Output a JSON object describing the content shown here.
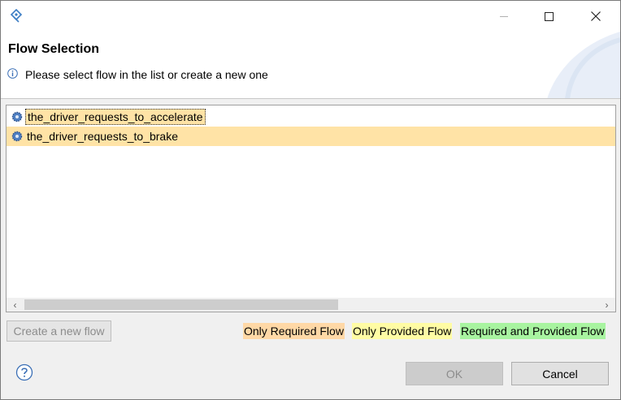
{
  "window": {
    "app_icon": "capella-app-icon",
    "controls": {
      "minimize": "minimize-icon",
      "maximize": "maximize-icon",
      "close": "close-icon"
    }
  },
  "header": {
    "title": "Flow Selection",
    "message": "Please select flow in the list or create a new one",
    "message_icon": "info-icon"
  },
  "flow_list": {
    "items": [
      {
        "label": "the_driver_requests_to_accelerate",
        "icon": "gear-flow-icon",
        "focused": true
      },
      {
        "label": "the_driver_requests_to_brake",
        "icon": "gear-flow-icon",
        "selected": true
      }
    ],
    "scrollbar": {
      "left_arrow": "‹",
      "right_arrow": "›"
    }
  },
  "actions": {
    "create_label": "Create a new flow",
    "ok_label": "OK",
    "cancel_label": "Cancel",
    "help_icon": "help-icon"
  },
  "legend": {
    "required": {
      "label": "Only Required Flow",
      "color": "#ffd8a6"
    },
    "provided": {
      "label": "Only Provided Flow",
      "color": "#fffca4"
    },
    "both": {
      "label": "Required and Provided Flow",
      "color": "#a8f4a0"
    }
  },
  "colors": {
    "selection": "#ffe3a6",
    "header_bg": "#ffffff",
    "dialog_bg": "#f0f0f0"
  }
}
